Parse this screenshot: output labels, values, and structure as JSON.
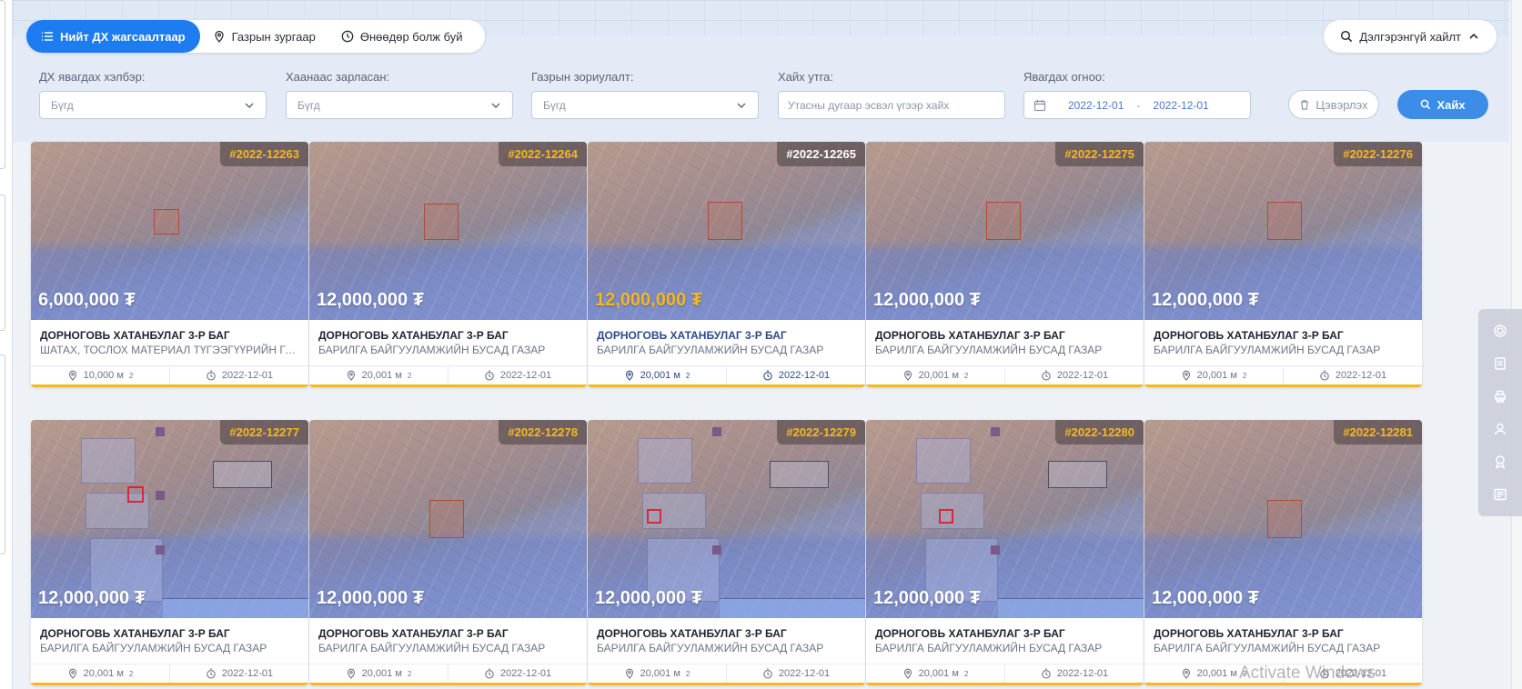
{
  "tabs": [
    {
      "label": "Нийт ДХ жагсаалтаар",
      "active": true,
      "icon": "list-icon"
    },
    {
      "label": "Газрын зургаар",
      "active": false,
      "icon": "map-pin-icon"
    },
    {
      "label": "Өнөөдөр болж буй",
      "active": false,
      "icon": "clock-icon"
    }
  ],
  "advanced_search": {
    "label": "Дэлгэрэнгүй хайлт"
  },
  "filters": {
    "auction_type": {
      "label": "ДХ явагдах хэлбэр:",
      "value": "Бүгд"
    },
    "announcer": {
      "label": "Хаанаас зарласан:",
      "value": "Бүгд"
    },
    "land_purpose": {
      "label": "Газрын зориулалт:",
      "value": "Бүгд"
    },
    "search": {
      "label": "Хайх утга:",
      "placeholder": "Утасны дугаар эсвэл үгээр хайх"
    },
    "date": {
      "label": "Явагдах огноо:",
      "from": "2022-12-01",
      "separator": "-",
      "to": "2022-12-01"
    }
  },
  "buttons": {
    "clear": "Цэвэрлэх",
    "search": "Хайх"
  },
  "colors": {
    "accent": "#1c7cf0",
    "gold": "#f5b820",
    "badge_bg": "#463c3c"
  },
  "cards": [
    {
      "code": "#2022-12263",
      "price": "6,000,000 ₮",
      "location": "ДОРНОГОВЬ ХАТАНБУЛАГ 3-Р БАГ",
      "purpose": "ШАТАХ, ТОСЛОХ МАТЕРИАЛ ТҮГЭЭГҮҮРИЙН ГАЗАР",
      "area": "10,000 м",
      "date": "2022-12-01",
      "highlight": false
    },
    {
      "code": "#2022-12264",
      "price": "12,000,000 ₮",
      "location": "ДОРНОГОВЬ ХАТАНБУЛАГ 3-Р БАГ",
      "purpose": "БАРИЛГА БАЙГУУЛАМЖИЙН БУСАД ГАЗАР",
      "area": "20,001 м",
      "date": "2022-12-01",
      "highlight": false
    },
    {
      "code": "#2022-12265",
      "price": "12,000,000 ₮",
      "location": "ДОРНОГОВЬ ХАТАНБУЛАГ 3-Р БАГ",
      "purpose": "БАРИЛГА БАЙГУУЛАМЖИЙН БУСАД ГАЗАР",
      "area": "20,001 м",
      "date": "2022-12-01",
      "highlight": true
    },
    {
      "code": "#2022-12275",
      "price": "12,000,000 ₮",
      "location": "ДОРНОГОВЬ ХАТАНБУЛАГ 3-Р БАГ",
      "purpose": "БАРИЛГА БАЙГУУЛАМЖИЙН БУСАД ГАЗАР",
      "area": "20,001 м",
      "date": "2022-12-01",
      "highlight": false
    },
    {
      "code": "#2022-12276",
      "price": "12,000,000 ₮",
      "location": "ДОРНОГОВЬ ХАТАНБУЛАГ 3-Р БАГ",
      "purpose": "БАРИЛГА БАЙГУУЛАМЖИЙН БУСАД ГАЗАР",
      "area": "20,001 м",
      "date": "2022-12-01",
      "highlight": false
    },
    {
      "code": "#2022-12277",
      "price": "12,000,000 ₮",
      "location": "ДОРНОГОВЬ ХАТАНБУЛАГ 3-Р БАГ",
      "purpose": "БАРИЛГА БАЙГУУЛАМЖИЙН БУСАД ГАЗАР",
      "area": "20,001 м",
      "date": "2022-12-01",
      "highlight": false
    },
    {
      "code": "#2022-12278",
      "price": "12,000,000 ₮",
      "location": "ДОРНОГОВЬ ХАТАНБУЛАГ 3-Р БАГ",
      "purpose": "БАРИЛГА БАЙГУУЛАМЖИЙН БУСАД ГАЗАР",
      "area": "20,001 м",
      "date": "2022-12-01",
      "highlight": false
    },
    {
      "code": "#2022-12279",
      "price": "12,000,000 ₮",
      "location": "ДОРНОГОВЬ ХАТАНБУЛАГ 3-Р БАГ",
      "purpose": "БАРИЛГА БАЙГУУЛАМЖИЙН БУСАД ГАЗАР",
      "area": "20,001 м",
      "date": "2022-12-01",
      "highlight": false
    },
    {
      "code": "#2022-12280",
      "price": "12,000,000 ₮",
      "location": "ДОРНОГОВЬ ХАТАНБУЛАГ 3-Р БАГ",
      "purpose": "БАРИЛГА БАЙГУУЛАМЖИЙН БУСАД ГАЗАР",
      "area": "20,001 м",
      "date": "2022-12-01",
      "highlight": false
    },
    {
      "code": "#2022-12281",
      "price": "12,000,000 ₮",
      "location": "ДОРНОГОВЬ ХАТАНБУЛАГ 3-Р БАГ",
      "purpose": "БАРИЛГА БАЙГУУЛАМЖИЙН БУСАД ГАЗАР",
      "area": "20,001 м",
      "date": "2022-12-01",
      "highlight": false
    }
  ],
  "area_unit_sup": "2",
  "side_tools": [
    "target-icon",
    "document-icon",
    "printer-icon",
    "person-icon",
    "award-icon",
    "newspaper-icon"
  ],
  "watermark": "Activate Windows"
}
